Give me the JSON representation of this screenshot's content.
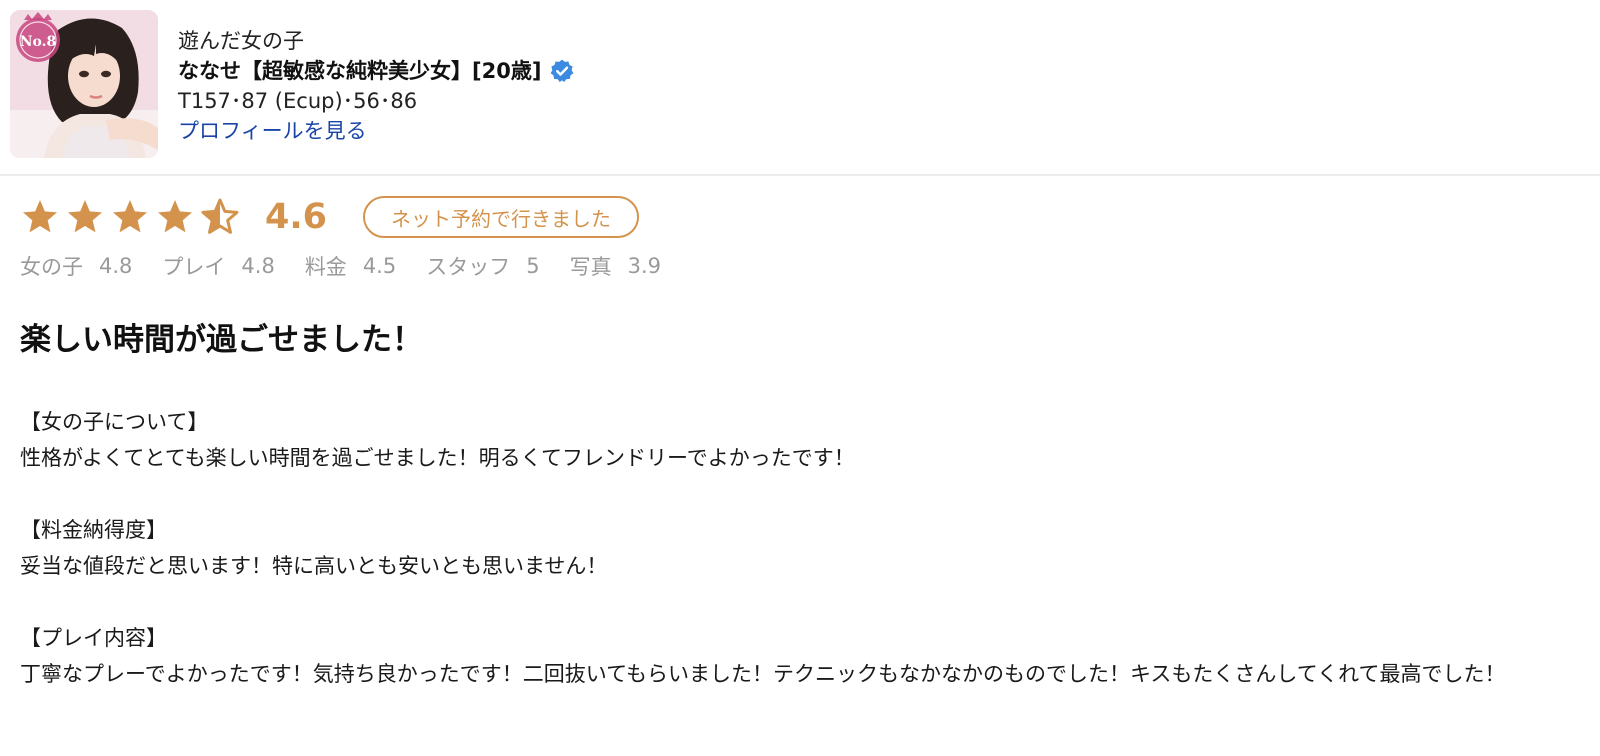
{
  "profile": {
    "visited_label": "遊んだ女の子",
    "name": "ななせ【超敏感な純粋美少女】[20歳]",
    "stats": "T157･87 (Ecup)･56･86",
    "profile_link": "プロフィールを見る",
    "verified_icon": "verified-check-icon",
    "avatar_badge_text": "No.8"
  },
  "rating": {
    "overall": "4.6",
    "stars_filled": 4.5,
    "stars_total": 5,
    "star_color": "#d4934d",
    "booking_badge": "ネット予約で行きました",
    "sub_scores": [
      {
        "label": "女の子",
        "value": "4.8"
      },
      {
        "label": "プレイ",
        "value": "4.8"
      },
      {
        "label": "料金",
        "value": "4.5"
      },
      {
        "label": "スタッフ",
        "value": "5"
      },
      {
        "label": "写真",
        "value": "3.9"
      }
    ]
  },
  "review": {
    "title": "楽しい時間が過ごせました！",
    "sections": [
      {
        "heading": "【女の子について】",
        "text": "性格がよくてとても楽しい時間を過ごせました！明るくてフレンドリーでよかったです！"
      },
      {
        "heading": "【料金納得度】",
        "text": "妥当な値段だと思います！特に高いとも安いとも思いません！"
      },
      {
        "heading": "【プレイ内容】",
        "text": "丁寧なプレーでよかったです！気持ち良かったです！二回抜いてもらいました！テクニックもなかなかのものでした！キスもたくさんしてくれて最高でした！"
      }
    ]
  },
  "colors": {
    "accent": "#d4934d",
    "link": "#1a44a8",
    "verified": "#3d8be0",
    "muted": "#9a9a9a"
  }
}
